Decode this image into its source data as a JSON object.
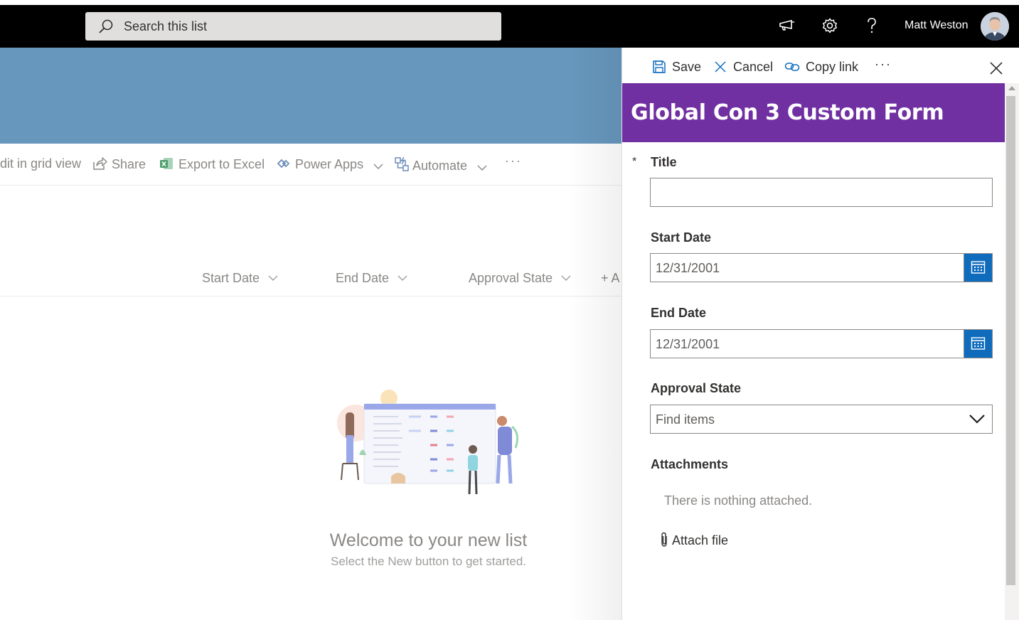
{
  "suitebar": {
    "search_placeholder": "Search this list",
    "user_name": "Matt Weston",
    "icons": [
      "search-icon",
      "megaphone-icon",
      "gear-icon",
      "help-icon",
      "avatar"
    ]
  },
  "commandbar": {
    "items": [
      {
        "label": "dit in grid view",
        "icon": "grid-icon"
      },
      {
        "label": "Share",
        "icon": "share-icon"
      },
      {
        "label": "Export to Excel",
        "icon": "excel-icon"
      },
      {
        "label": "Power Apps",
        "icon": "powerapps-icon"
      },
      {
        "label": "Automate",
        "icon": "automate-icon"
      }
    ],
    "more": "···"
  },
  "list": {
    "columns": [
      {
        "label": "Start Date"
      },
      {
        "label": "End Date"
      },
      {
        "label": "Approval State"
      }
    ],
    "add_column": "+ A",
    "welcome_title": "Welcome to your new list",
    "welcome_subtitle": "Select the New button to get started."
  },
  "panel": {
    "toolbar": {
      "save": "Save",
      "cancel": "Cancel",
      "copy_link": "Copy link",
      "more": "···"
    },
    "header_title": "Global Con 3 Custom Form",
    "header_color": "#7130a2",
    "fields": {
      "title": {
        "label": "Title",
        "required_mark": "*",
        "value": ""
      },
      "start_date": {
        "label": "Start Date",
        "value": "12/31/2001"
      },
      "end_date": {
        "label": "End Date",
        "value": "12/31/2001"
      },
      "approval_state": {
        "label": "Approval State",
        "value": "Find items"
      },
      "attachments": {
        "label": "Attachments",
        "empty_text": "There is nothing attached.",
        "attach_label": "Attach file"
      }
    }
  },
  "colors": {
    "suitebar": "#000000",
    "banner": "#6797bd",
    "accent": "#0f6cbd"
  }
}
